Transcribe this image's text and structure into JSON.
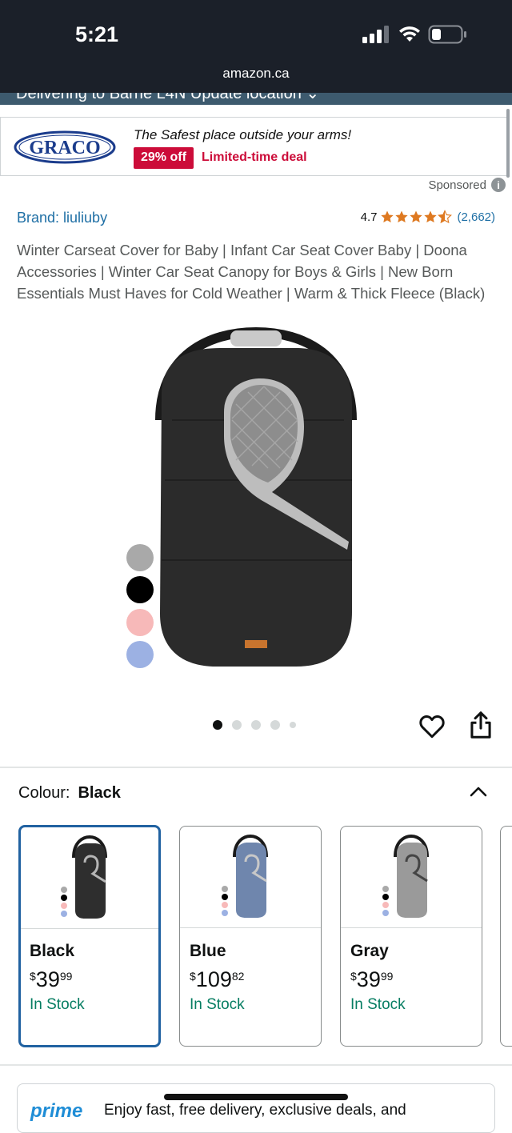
{
  "status_bar": {
    "time": "5:21",
    "url": "amazon.ca"
  },
  "delivery": {
    "text": "Delivering to Barrie L4N    Update location ⌄"
  },
  "ad": {
    "brand_logo_text": "GRACO",
    "tagline": "The Safest place outside your arms!",
    "discount_badge": "29% off",
    "deal_label": "Limited-time deal",
    "sponsored_label": "Sponsored"
  },
  "product": {
    "brand": "Brand: liuliuby",
    "rating_value": "4.7",
    "rating_stars": 4.5,
    "rating_count": "(2,662)",
    "title": "Winter Carseat Cover for Baby | Infant Car Seat Cover Baby | Doona Accessories | Winter Car Seat Canopy for Boys & Girls | New Born Essentials Must Haves for Cold Weather | Warm & Thick Fleece (Black)"
  },
  "gallery": {
    "image_count": 5,
    "active_index": 0,
    "swatch_colors": [
      "#a9a9a9",
      "#000000",
      "#f7b9b9",
      "#9cb1e3"
    ],
    "heart_icon": "heart-icon",
    "share_icon": "share-icon"
  },
  "colour_selector": {
    "label": "Colour:",
    "selected_value": "Black",
    "options": [
      {
        "name": "Black",
        "price_symbol": "$",
        "price_whole": "39",
        "price_fraction": "99",
        "stock": "In Stock",
        "color": "#2e2e2e"
      },
      {
        "name": "Blue",
        "price_symbol": "$",
        "price_whole": "109",
        "price_fraction": "82",
        "stock": "In Stock",
        "color": "#6f86ad"
      },
      {
        "name": "Gray",
        "price_symbol": "$",
        "price_whole": "39",
        "price_fraction": "99",
        "stock": "In Stock",
        "color": "#9a9a9a"
      }
    ]
  },
  "prime": {
    "logo": "prime",
    "text": "Enjoy fast, free delivery, exclusive deals, and"
  },
  "colors": {
    "status_bar_bg": "#1b2029",
    "link_blue": "#1f6fa5",
    "deal_red": "#cc0c39",
    "stock_green": "#067d62",
    "selected_border": "#2162a1",
    "star_orange": "#de7921"
  }
}
